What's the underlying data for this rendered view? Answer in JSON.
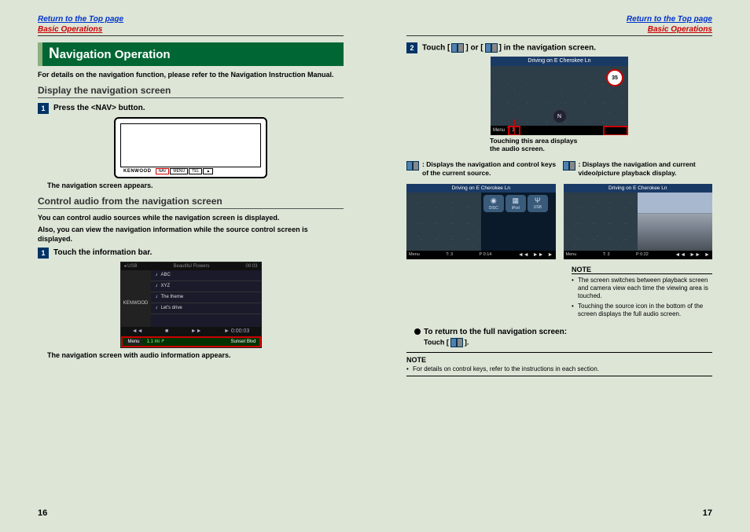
{
  "links": {
    "top": "Return to the Top page",
    "basic": "Basic Operations"
  },
  "left": {
    "section_title_first": "N",
    "section_title_rest": "avigation Operation",
    "intro": "For details on the navigation function, please refer to the Navigation Instruction Manual.",
    "sub1": "Display the navigation screen",
    "step1_num": "1",
    "step1": "Press the <NAV> button.",
    "device_brand": "KENWOOD",
    "device_buttons": [
      "NAV",
      "MENU",
      "TEL",
      "▲"
    ],
    "caption1": "The navigation screen appears.",
    "sub2": "Control audio from the navigation screen",
    "sub2_text1": "You can control audio sources while the navigation screen is displayed.",
    "sub2_text2": "Also, you can view the navigation information while the source control screen is displayed.",
    "step2_num": "1",
    "step2": "Touch the information bar.",
    "ns_top_left": "◂ USB",
    "ns_top_mid": "Beautiful Flowers",
    "ns_top_right": "00:03",
    "ns_brand": "KENWOOD",
    "ns_items": [
      "ABC",
      "XYZ",
      "The theme",
      "Let's drive"
    ],
    "ns_time": "► 0:00:03",
    "ns_menu": "Menu",
    "ns_dist": "1.1 mi ↱",
    "ns_dest": "Sunset Blvd",
    "caption2": "The navigation screen with audio information appears."
  },
  "right": {
    "step2_num": "2",
    "step2_a": "Touch [",
    "step2_b": "] or [",
    "step2_c": "] in the navigation screen.",
    "map_title": "Driving on E Cherokee Ln",
    "map_speed": "35",
    "map_compass": "N",
    "map_menu": "Menu",
    "map_t": "T: 3",
    "map_caption1": "Touching this area displays",
    "map_caption2": "the audio screen.",
    "icon1_desc": ": Displays the navigation and control keys of the current source.",
    "icon2_desc": ": Displays the navigation and current video/picture playback display.",
    "sm_title": "Driving on E Cherokee Ln",
    "sm_ctrls": [
      {
        "icon": "◉",
        "label": "DISC"
      },
      {
        "icon": "▦",
        "label": "iPod"
      },
      {
        "icon": "Ψ",
        "label": "USB"
      }
    ],
    "sm_menu": "Menu",
    "sm_t": "T: 3",
    "sm_p": "P 0:14",
    "sm_p2": "P 0:22",
    "note_title": "NOTE",
    "note_items": [
      "The screen switches between playback screen and camera view each time the viewing area is touched.",
      "Touching the source icon in the bottom of the screen displays the full audio screen."
    ],
    "return_title": "To return to the full navigation screen:",
    "return_sub_a": "Touch [",
    "return_sub_b": "].",
    "bottom_note_title": "NOTE",
    "bottom_note_item": "For details on control keys, refer to the instructions in each section."
  },
  "page_left_num": "16",
  "page_right_num": "17"
}
